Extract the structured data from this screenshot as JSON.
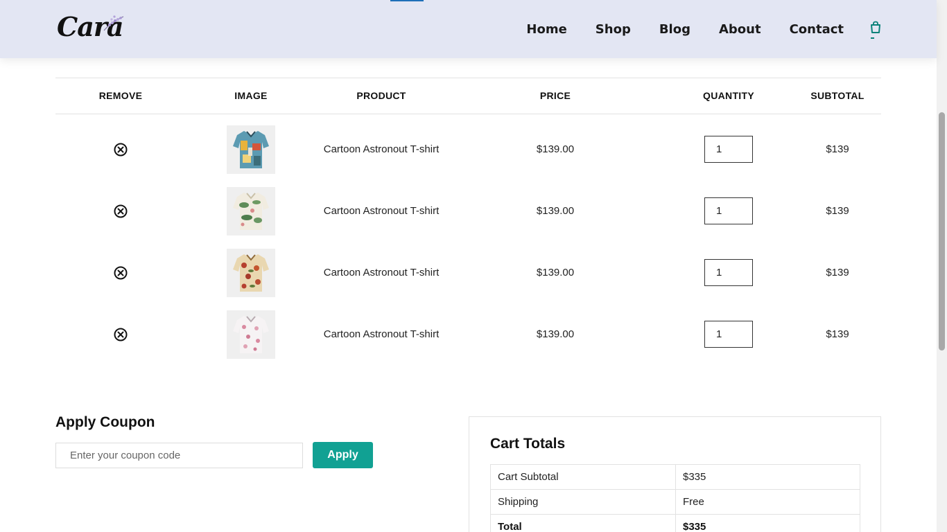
{
  "header": {
    "logo_text": "Cara",
    "nav": [
      "Home",
      "Shop",
      "Blog",
      "About",
      "Contact"
    ],
    "cart_icon": "shopping-bag-icon"
  },
  "table": {
    "headers": [
      "REMOVE",
      "IMAGE",
      "PRODUCT",
      "PRICE",
      "QUANTITY",
      "SUBTOTAL"
    ],
    "rows": [
      {
        "product": "Cartoon Astronout T-shirt",
        "price": "$139.00",
        "quantity": "1",
        "subtotal": "$139",
        "remove_icon": "circle-x-icon"
      },
      {
        "product": "Cartoon Astronout T-shirt",
        "price": "$139.00",
        "quantity": "1",
        "subtotal": "$139",
        "remove_icon": "circle-x-icon"
      },
      {
        "product": "Cartoon Astronout T-shirt",
        "price": "$139.00",
        "quantity": "1",
        "subtotal": "$139",
        "remove_icon": "circle-x-icon"
      },
      {
        "product": "Cartoon Astronout T-shirt",
        "price": "$139.00",
        "quantity": "1",
        "subtotal": "$139",
        "remove_icon": "circle-x-icon"
      }
    ]
  },
  "coupon": {
    "title": "Apply Coupon",
    "placeholder": "Enter your coupon code",
    "button": "Apply"
  },
  "totals": {
    "title": "Cart Totals",
    "rows": [
      {
        "label": "Cart Subtotal",
        "value": "$335"
      },
      {
        "label": "Shipping",
        "value": "Free"
      },
      {
        "label": "Total",
        "value": "$335"
      }
    ]
  },
  "colors": {
    "header_bg": "#e3e6f3",
    "accent": "#11a193",
    "cart_icon": "#088178"
  }
}
